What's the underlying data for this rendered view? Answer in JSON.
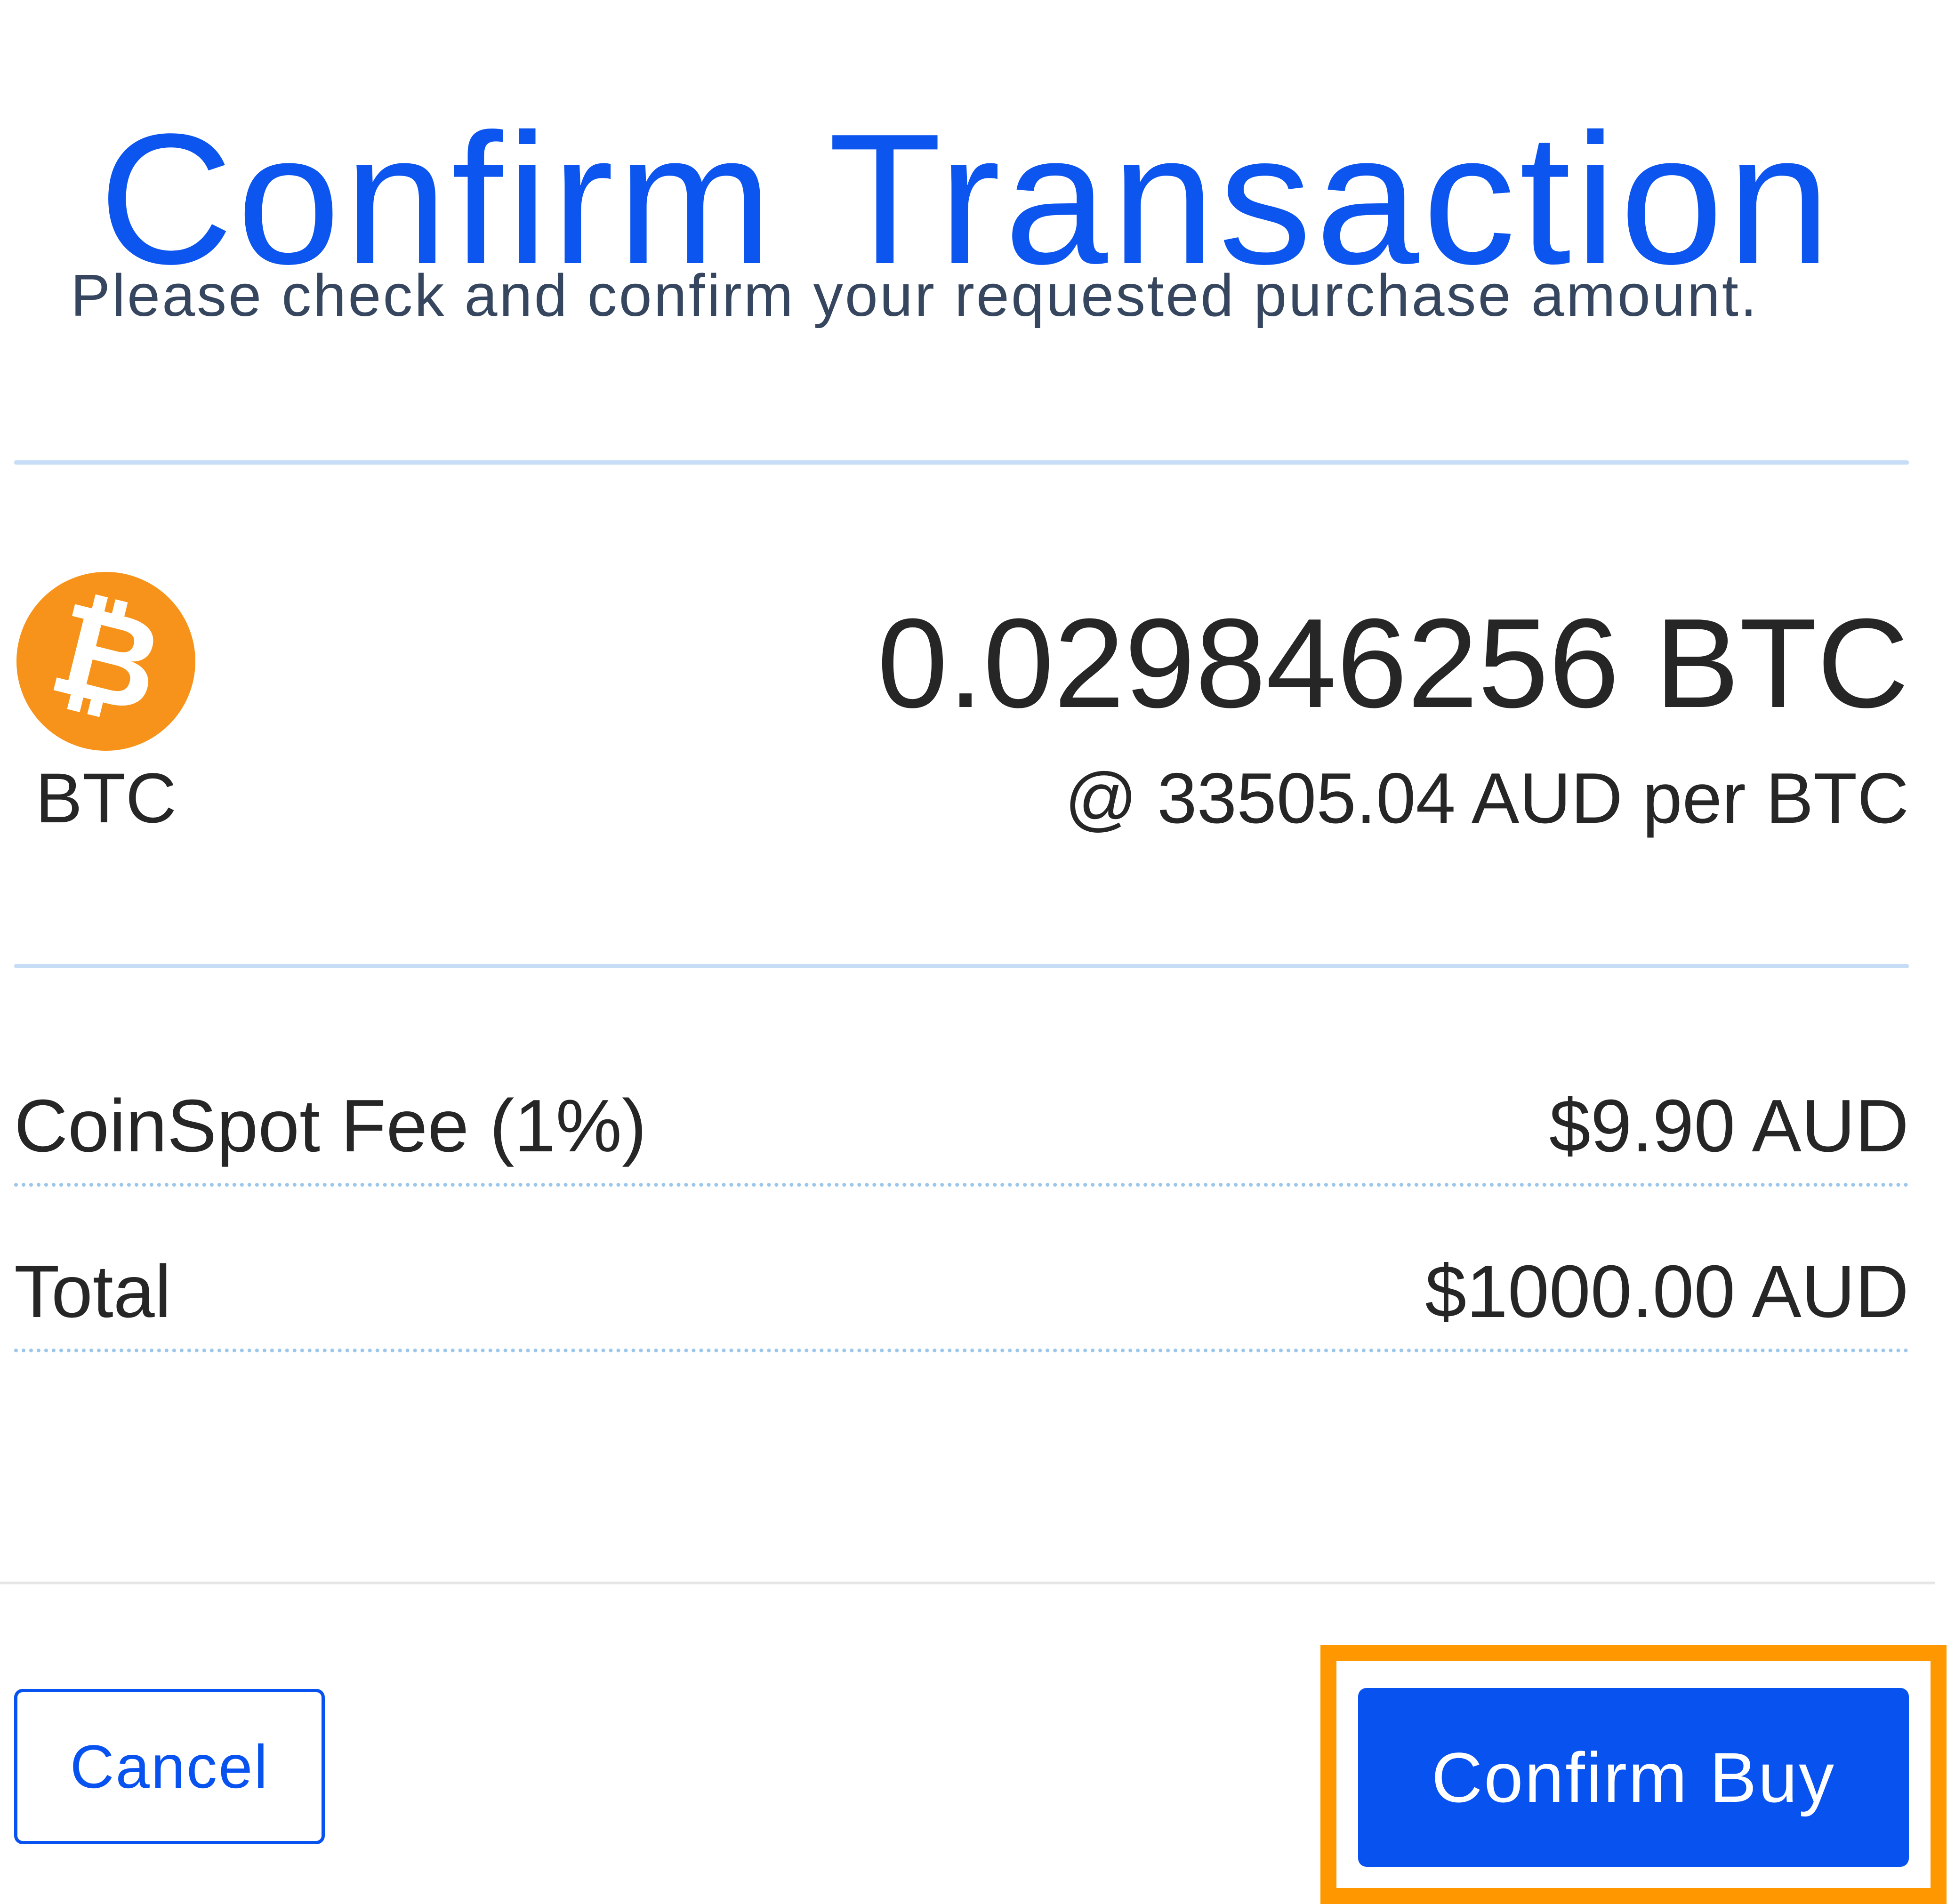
{
  "header": {
    "title": "Confirm Transaction",
    "subtitle": "Please check and confirm your requested purchase amount."
  },
  "coin": {
    "symbol": "BTC",
    "icon": "bitcoin-icon",
    "amount": "0.029846256 BTC",
    "rate": "@ 33505.04 AUD per BTC"
  },
  "summary": {
    "fee_label": "CoinSpot Fee (1%)",
    "fee_value": "$9.90 AUD",
    "total_label": "Total",
    "total_value": "$1000.00 AUD"
  },
  "actions": {
    "cancel_label": "Cancel",
    "confirm_label": "Confirm Buy"
  },
  "colors": {
    "title": "#0c55ee",
    "subtitle": "#35465e",
    "text": "#262626",
    "primary": "#0852f0",
    "divider": "#c7ddf6",
    "dotted": "#9cc7ea",
    "footer_divider": "#e6e6e6",
    "bitcoin": "#f7931a",
    "highlight": "#ff9800"
  }
}
